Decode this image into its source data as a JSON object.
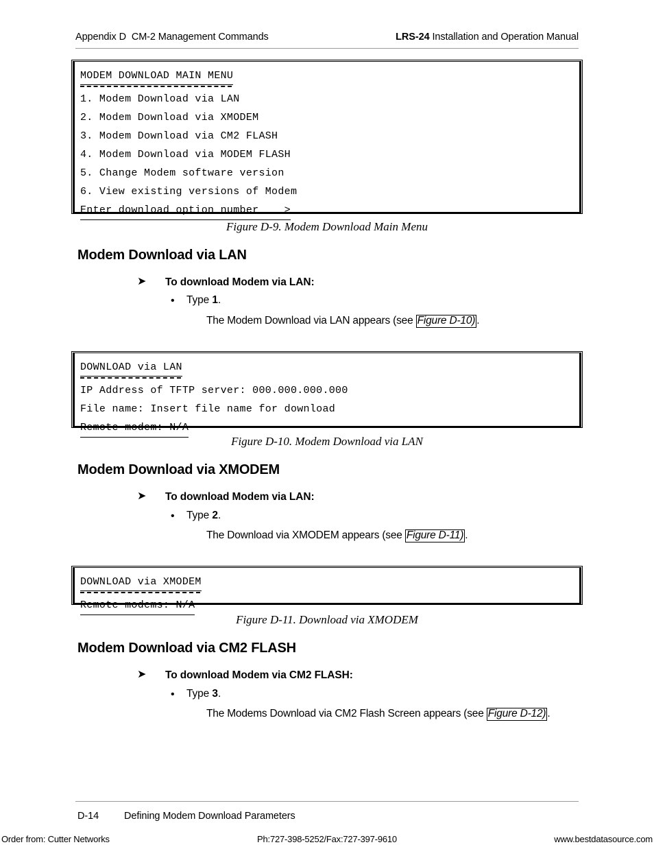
{
  "header": {
    "left": "Appendix D  CM-2 Management Commands",
    "right_bold": "LRS-24",
    "right_rest": " Installation and Operation Manual"
  },
  "figures": {
    "d9": {
      "title": "MODEM DOWNLOAD MAIN MENU",
      "lines": [
        "1. Modem Download via LAN",
        "2. Modem Download via XMODEM",
        "3. Modem Download via CM2 FLASH",
        "4. Modem Download via MODEM FLASH",
        "5. Change Modem software version",
        "6. View existing versions of Modem"
      ],
      "prompt": "Enter download option number ___>",
      "caption": "Figure D-9.  Modem Download Main Menu"
    },
    "d10": {
      "title": "DOWNLOAD via LAN",
      "lines": [
        "IP Address of TFTP server: 000.000.000.000",
        "File name: Insert file name for download"
      ],
      "prompt": "Remote modem: N/A",
      "caption": "Figure D-10.  Modem Download via LAN"
    },
    "d11": {
      "title": "DOWNLOAD via XMODEM",
      "lines": [],
      "prompt": "Remote modems: N/A",
      "caption": "Figure D-11.  Download via XMODEM"
    }
  },
  "sections": {
    "lan": {
      "heading": "Modem Download via LAN",
      "arrow": "➤",
      "proc_title": "To download Modem via LAN:",
      "bullet": "•",
      "step_prefix": "Type ",
      "step_key": "1",
      "step_suffix": ".",
      "result_before": "The Modem Download via LAN appears (see ",
      "result_link": "Figure D-10)",
      "result_after": "."
    },
    "xmodem": {
      "heading": "Modem Download via XMODEM",
      "arrow": "➤",
      "proc_title": "To download Modem via LAN:",
      "bullet": "•",
      "step_prefix": "Type ",
      "step_key": "2",
      "step_suffix": ".",
      "result_before": "The Download via XMODEM appears (see ",
      "result_link": "Figure D-11)",
      "result_after": "."
    },
    "cm2flash": {
      "heading": "Modem Download via CM2 FLASH",
      "arrow": "➤",
      "proc_title": "To download Modem via CM2 FLASH:",
      "bullet": "•",
      "step_prefix": "Type ",
      "step_key": "3",
      "step_suffix": ".",
      "result_before": "The Modems Download via CM2 Flash Screen appears (see ",
      "result_link": "Figure D-12)",
      "result_after": "."
    }
  },
  "footer": {
    "page_number": "D-14",
    "page_title": "Defining Modem Download Parameters"
  },
  "banner": {
    "left": "Order from: Cutter Networks",
    "middle": "Ph:727-398-5252/Fax:727-397-9610",
    "right": "www.bestdatasource.com"
  }
}
